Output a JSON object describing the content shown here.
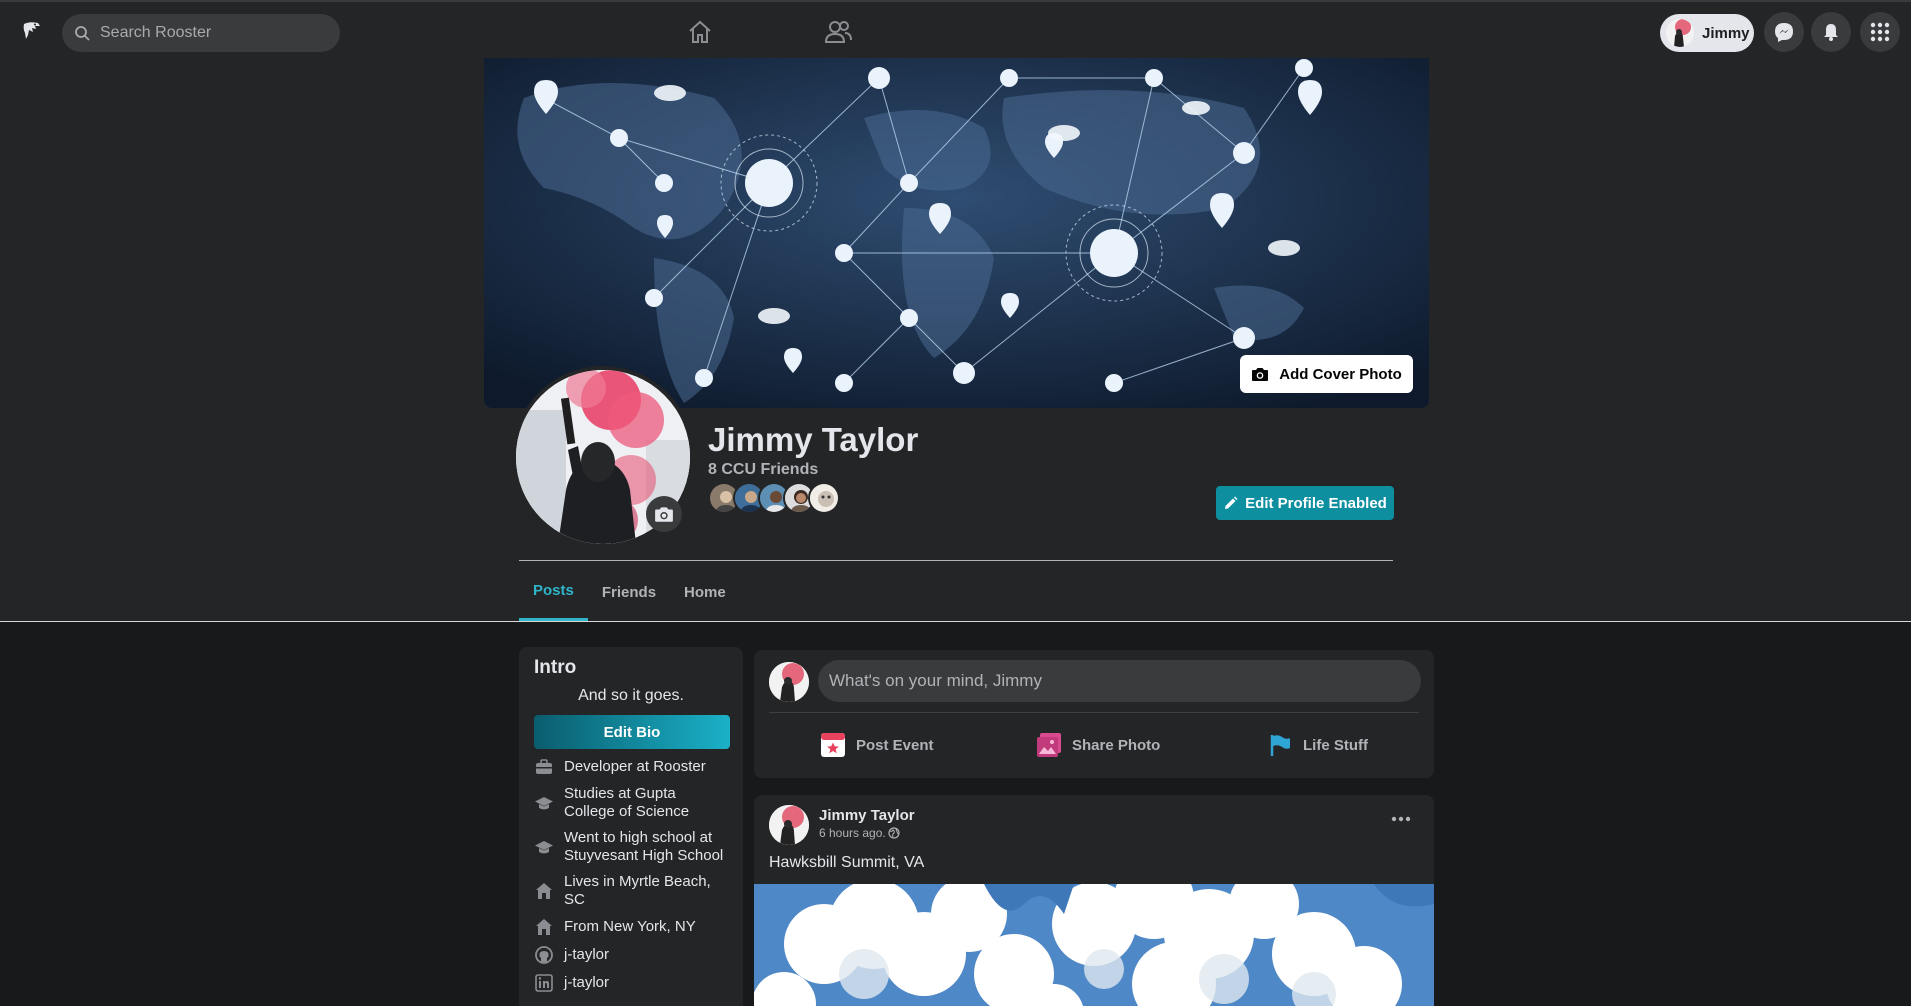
{
  "app": {
    "name": "Rooster"
  },
  "search": {
    "placeholder": "Search Rooster"
  },
  "nav": {
    "home_icon": "home-icon",
    "friends_icon": "friends-icon"
  },
  "user_menu": {
    "name": "Jimmy"
  },
  "header_icons": [
    "messenger-icon",
    "bell-icon",
    "grid-menu-icon"
  ],
  "profile": {
    "name": "Jimmy Taylor",
    "friend_count": "8 CCU Friends",
    "cover_button": "Add Cover Photo",
    "edit_button": "Edit Profile Enabled"
  },
  "tabs": [
    {
      "label": "Posts",
      "active": true
    },
    {
      "label": "Friends",
      "active": false
    },
    {
      "label": "Home",
      "active": false
    }
  ],
  "intro": {
    "title": "Intro",
    "bio": "And so it goes.",
    "edit_bio": "Edit Bio",
    "items": [
      {
        "icon": "briefcase-icon",
        "text": "Developer at Rooster"
      },
      {
        "icon": "graduation-cap-icon",
        "text": "Studies at Gupta College of Science"
      },
      {
        "icon": "graduation-cap-icon",
        "text": "Went to high school at Stuyvesant High School"
      },
      {
        "icon": "house-icon",
        "text": "Lives in Myrtle Beach, SC"
      },
      {
        "icon": "house-icon",
        "text": "From New York, NY"
      },
      {
        "icon": "github-icon",
        "text": "j-taylor"
      },
      {
        "icon": "linkedin-icon",
        "text": "j-taylor"
      }
    ]
  },
  "composer": {
    "placeholder": "What's on your mind, Jimmy",
    "actions": [
      {
        "icon": "calendar-icon",
        "label": "Post Event"
      },
      {
        "icon": "photo-icon",
        "label": "Share Photo"
      },
      {
        "icon": "flag-icon",
        "label": "Life Stuff"
      }
    ]
  },
  "post": {
    "author": "Jimmy Taylor",
    "time": "6 hours ago.",
    "text": "Hawksbill Summit, VA"
  },
  "colors": {
    "accent": "#2fb5c9",
    "background": "#18191a",
    "surface": "#242526"
  }
}
